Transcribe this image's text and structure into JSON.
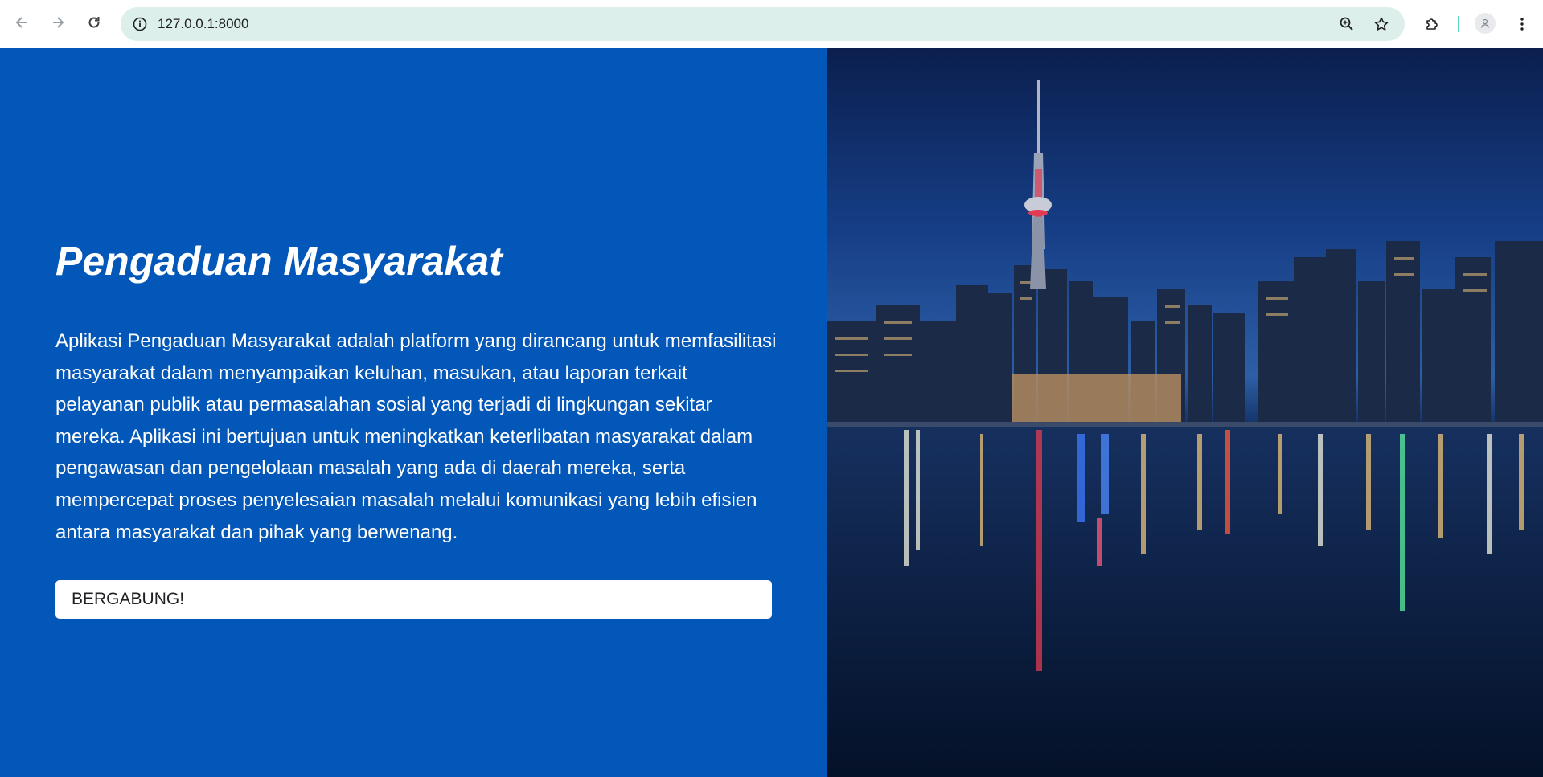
{
  "browser": {
    "url": "127.0.0.1:8000",
    "icons": {
      "back": "arrow-left-icon",
      "forward": "arrow-right-icon",
      "reload": "reload-icon",
      "info": "info-icon",
      "zoom": "zoom-icon",
      "bookmark": "star-icon",
      "extensions": "puzzle-icon",
      "profile": "profile-icon",
      "menu": "kebab-menu-icon"
    }
  },
  "hero": {
    "title": "Pengaduan Masyarakat",
    "description": "Aplikasi Pengaduan Masyarakat adalah platform yang dirancang untuk memfasilitasi masyarakat dalam menyampaikan keluhan, masukan, atau laporan terkait pelayanan publik atau permasalahan sosial yang terjadi di lingkungan sekitar mereka. Aplikasi ini bertujuan untuk meningkatkan keterlibatan masyarakat dalam pengawasan dan pengelolaan masalah yang ada di daerah mereka, serta mempercepat proses penyelesaian masalah melalui komunikasi yang lebih efisien antara masyarakat dan pihak yang berwenang.",
    "button_label": "BERGABUNG!"
  },
  "colors": {
    "primary": "#0357b8",
    "omnibox": "#dcefea"
  }
}
